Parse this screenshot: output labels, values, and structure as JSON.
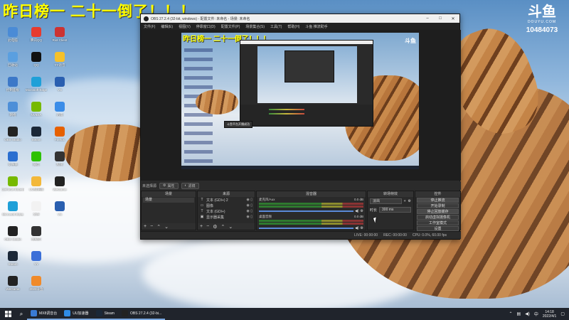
{
  "overlay": {
    "headline": "昨日榜一 二十一倒了！！！"
  },
  "brand": {
    "logo": "斗鱼",
    "sub": "DOUYU.COM",
    "room_id": "10484073"
  },
  "desktop_icons": [
    {
      "label": "此电脑",
      "icon": "computer-icon",
      "color": "#4a8bd6"
    },
    {
      "label": "腾讯QQ",
      "icon": "qq-icon",
      "color": "#e63b2e"
    },
    {
      "label": "Riot Client",
      "icon": "riot-icon",
      "color": "#c33"
    },
    {
      "label": "回收站",
      "icon": "recycle-bin-icon",
      "color": "#5a9fe0"
    },
    {
      "label": "QQ",
      "icon": "qq-icon",
      "color": "#111"
    },
    {
      "label": "YY语音",
      "icon": "yy-icon",
      "color": "#f6c12a"
    },
    {
      "label": "控制面板",
      "icon": "control-panel-icon",
      "color": "#3c78c8"
    },
    {
      "label": "Microsoft Edge",
      "icon": "edge-icon",
      "color": "#1fa0d8"
    },
    {
      "label": "VS",
      "icon": "vs-icon",
      "color": "#2a5fb0"
    },
    {
      "label": "网络",
      "icon": "network-icon",
      "color": "#4d8fd8"
    },
    {
      "label": "NVIDIA",
      "icon": "nvidia-icon",
      "color": "#76b900"
    },
    {
      "label": "迅雷",
      "icon": "thunder-icon",
      "color": "#3b8de8"
    },
    {
      "label": "OBS Studio",
      "icon": "obs-icon",
      "color": "#222"
    },
    {
      "label": "Steam",
      "icon": "steam-icon",
      "color": "#1b2838"
    },
    {
      "label": "Firefox",
      "icon": "firefox-icon",
      "color": "#e66000"
    },
    {
      "label": "文件夹",
      "icon": "folder-icon",
      "color": "#2b6fd0"
    },
    {
      "label": "微信",
      "icon": "wechat-icon",
      "color": "#2dc100"
    },
    {
      "label": "程序",
      "icon": "app-icon",
      "color": "#333"
    },
    {
      "label": "GeForce Experience",
      "icon": "geforce-icon",
      "color": "#76b900"
    },
    {
      "label": "UU加速器",
      "icon": "uu-icon",
      "color": "#f3b83a"
    },
    {
      "label": "WeGame",
      "icon": "wegame-icon",
      "color": "#222"
    },
    {
      "label": "Microsoft Edge",
      "icon": "edge-icon",
      "color": "#1fa0d8"
    },
    {
      "label": "文件",
      "icon": "file-icon",
      "color": "#f2f2f2"
    },
    {
      "label": "VS",
      "icon": "vs-icon",
      "color": "#2a5fb0"
    },
    {
      "label": "OBS Studio",
      "icon": "obs-icon",
      "color": "#222"
    },
    {
      "label": "鼠标宏",
      "icon": "mouse-icon",
      "color": "#333"
    },
    {
      "label": "",
      "icon": "blank-icon",
      "color": "transparent"
    },
    {
      "label": "Steam",
      "icon": "steam-icon",
      "color": "#1b2838"
    },
    {
      "label": "YY",
      "icon": "yy-icon",
      "color": "#3b6fd8"
    },
    {
      "label": "",
      "icon": "blank-icon",
      "color": "transparent"
    },
    {
      "label": "WeGame",
      "icon": "wegame-icon",
      "color": "#222"
    },
    {
      "label": "2022斗鱼",
      "icon": "douyu-icon",
      "color": "#f08a2a"
    },
    {
      "label": "",
      "icon": "blank-icon",
      "color": "transparent"
    }
  ],
  "obs": {
    "title": "OBS 27.2.4 (32-bit, windows) - 配置文件: 未命名 - 场景: 未命名",
    "menu": [
      "文件(F)",
      "编辑(E)",
      "视图(V)",
      "停靠窗口(D)",
      "配置文件(P)",
      "场景集合(S)",
      "工具(T)",
      "帮助(H)",
      "斗鱼 推流助手"
    ],
    "preview": {
      "headline": "昨日榜一 二十一倒了！！！",
      "brand": "斗鱼",
      "tooltip": "斗鱼平台开播成功"
    },
    "scene_bar": {
      "label": "未选择源",
      "props_button": "属性",
      "filters_button": "滤镜"
    },
    "docks": {
      "scenes": {
        "title": "场景",
        "items": [
          "场景"
        ]
      },
      "sources": {
        "title": "来源",
        "items": [
          {
            "icon": "text-icon",
            "glyph": "T",
            "label": "文本 (GDI+) 2"
          },
          {
            "icon": "image-icon",
            "glyph": "▭",
            "label": "图像"
          },
          {
            "icon": "text-icon",
            "glyph": "T",
            "label": "文本 (GDI+)"
          },
          {
            "icon": "display-icon",
            "glyph": "▣",
            "label": "显示器采集"
          }
        ]
      },
      "mixer": {
        "title": "混音器",
        "channels": [
          {
            "name": "麦克风/Aux",
            "db": "0.0 dB"
          },
          {
            "name": "桌面音频",
            "db": "0.0 dB"
          }
        ]
      },
      "transitions": {
        "title": "转场特效",
        "type": "淡出",
        "duration_label": "时长",
        "duration": "300 ms"
      },
      "controls": {
        "title": "控件",
        "buttons": [
          "停止推流",
          "开始录制",
          "停止回放缓存",
          "启动虚拟摄像机",
          "工作室模式",
          "设置",
          "退出"
        ]
      }
    },
    "statusbar": {
      "live_label": "LIVE: 00:00:00",
      "rec_label": "REC: 00:00:00",
      "cpu_label": "CPU: 0.0%, 60.00 fps"
    }
  },
  "taskbar": {
    "apps": [
      {
        "label": "MX8调音台",
        "icon": "mixer-app-icon",
        "color": "#3a7bd5"
      },
      {
        "label": "UU加速器",
        "icon": "uu-icon",
        "color": "#2f8ce6"
      },
      {
        "label": "Steam",
        "icon": "steam-icon",
        "color": "#1b2838"
      },
      {
        "label": "OBS 27.2.4 (32-bi...",
        "icon": "obs-icon",
        "color": "#222"
      }
    ],
    "time": "14:18",
    "date": "2022/4/1"
  }
}
